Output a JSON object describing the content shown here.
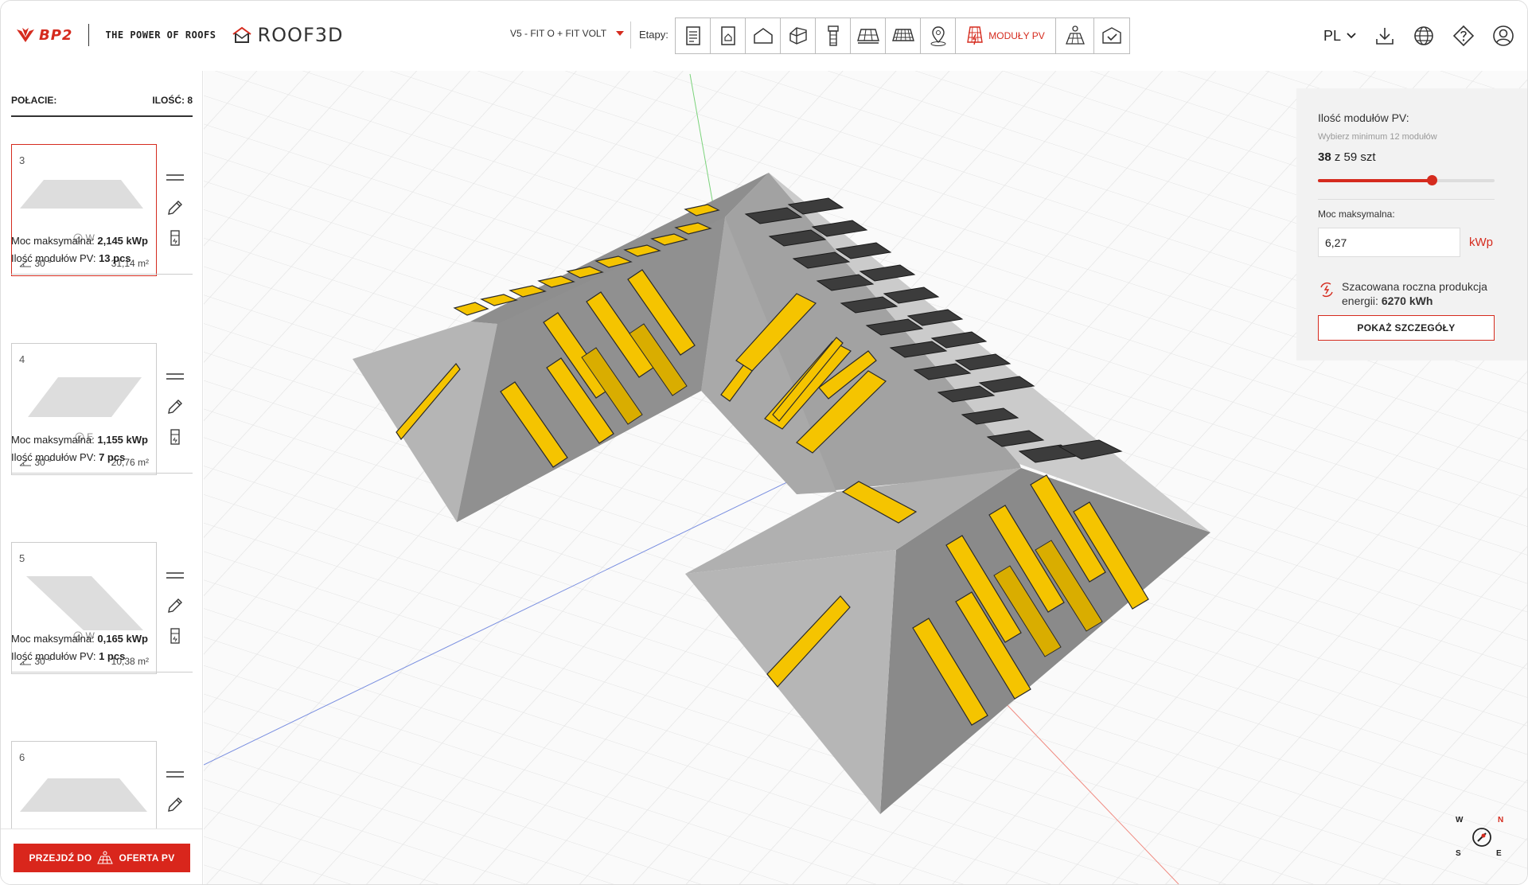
{
  "header": {
    "brand_name": "BP2",
    "tagline": "THE POWER OF ROOFS",
    "app_name": "ROOF3D",
    "variant": "V5 - FIT O + FIT VOLT",
    "stages_label": "Etapy:",
    "active_stage_label": "MODUŁY PV",
    "language": "PL",
    "icons": [
      "download-icon",
      "globe-icon",
      "help-icon",
      "user-icon"
    ],
    "stage_icons": [
      "document-icon",
      "document-house-icon",
      "house-outline-icon",
      "house-3d-icon",
      "chimney-icon",
      "roof-grid-icon",
      "roof-tiles-icon",
      "location-pin-icon",
      "pv-module-icon",
      "solar-panel-person-icon",
      "roof-check-icon"
    ]
  },
  "sidebar": {
    "heading": "POŁACIE:",
    "count": "ILOŚĆ: 8",
    "cards": [
      {
        "number": "3",
        "orientation": "W",
        "pitch": "30 °",
        "area": "31,14 m²",
        "power_label": "Moc maksymalna:",
        "power_value": "2,145 kWp",
        "modules_label": "Ilość modułów PV:",
        "modules_value": "13 pcs",
        "selected": true
      },
      {
        "number": "4",
        "orientation": "E",
        "pitch": "30 °",
        "area": "20,76 m²",
        "power_label": "Moc maksymalna:",
        "power_value": "1,155 kWp",
        "modules_label": "Ilość modułów PV:",
        "modules_value": "7 pcs",
        "selected": false
      },
      {
        "number": "5",
        "orientation": "W",
        "pitch": "30 °",
        "area": "10,38 m²",
        "power_label": "Moc maksymalna:",
        "power_value": "0,165 kWp",
        "modules_label": "Ilość modułów PV:",
        "modules_value": "1 pcs",
        "selected": false
      },
      {
        "number": "6",
        "selected": false
      }
    ],
    "cta_left": "PRZEJDŹ DO",
    "cta_right": "OFERTA PV"
  },
  "panel": {
    "title": "Ilość modułów PV:",
    "hint": "Wybierz minimum 12 modułów",
    "count_selected": "38",
    "count_sep": "z 59 szt",
    "slider_fraction": 0.644,
    "power_label": "Moc maksymalna:",
    "power_value": "6,27",
    "power_unit": "kWp",
    "energy_text": "Szacowana roczna produkcja energii:",
    "energy_value": "6270 kWh",
    "details_button": "POKAŻ SZCZEGÓŁY"
  },
  "compass": {
    "n": "N",
    "e": "E",
    "s": "S",
    "w": "W"
  },
  "colors": {
    "accent": "#d52b1e",
    "panel_yellow": "#f5c400",
    "panel_dark": "#3a3a3a",
    "roof_light": "#b3b3b3",
    "roof_dark": "#8f8f8f"
  }
}
